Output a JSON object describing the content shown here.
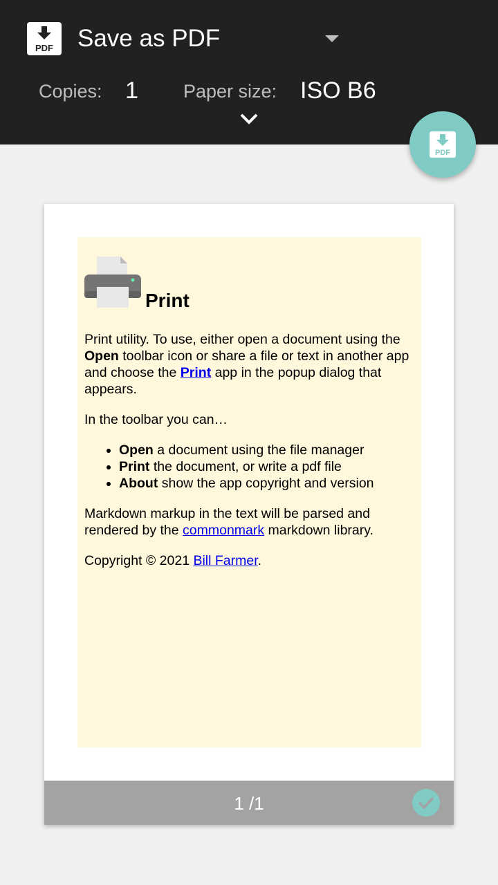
{
  "header": {
    "printer_name": "Save as PDF",
    "printer_icon": "pdf-download-icon",
    "copies_label": "Copies:",
    "copies_value": "1",
    "paper_size_label": "Paper size:",
    "paper_size_value": "ISO B6",
    "pdf_badge": "PDF"
  },
  "fab": {
    "icon": "pdf-download-icon",
    "label": "PDF"
  },
  "document": {
    "title": "Print",
    "intro_pre": "Print utility. To use, either open a document using the ",
    "intro_open": "Open",
    "intro_mid": " toolbar icon or share a file or text in another app and choose the ",
    "intro_link": "Print",
    "intro_post": " app in the popup dialog that appears.",
    "toolbar_intro": "In the toolbar you can…",
    "items": [
      {
        "bold": "Open",
        "text": " a document using the file manager"
      },
      {
        "bold": "Print",
        "text": " the document, or write a pdf file"
      },
      {
        "bold": "About",
        "text": " show the app copyright and version"
      }
    ],
    "markdown_pre": "Markdown markup in the text will be parsed and rendered by the ",
    "markdown_link": "commonmark",
    "markdown_post": " markdown library.",
    "copyright_pre": "Copyright © 2021 ",
    "copyright_link": "Bill Farmer",
    "copyright_post": "."
  },
  "preview": {
    "page_indicator": "1 /1"
  },
  "colors": {
    "toolbar": "#212121",
    "accent": "#80cbc4",
    "document_bg": "#fff8dc",
    "footer": "#a3a3a3"
  }
}
